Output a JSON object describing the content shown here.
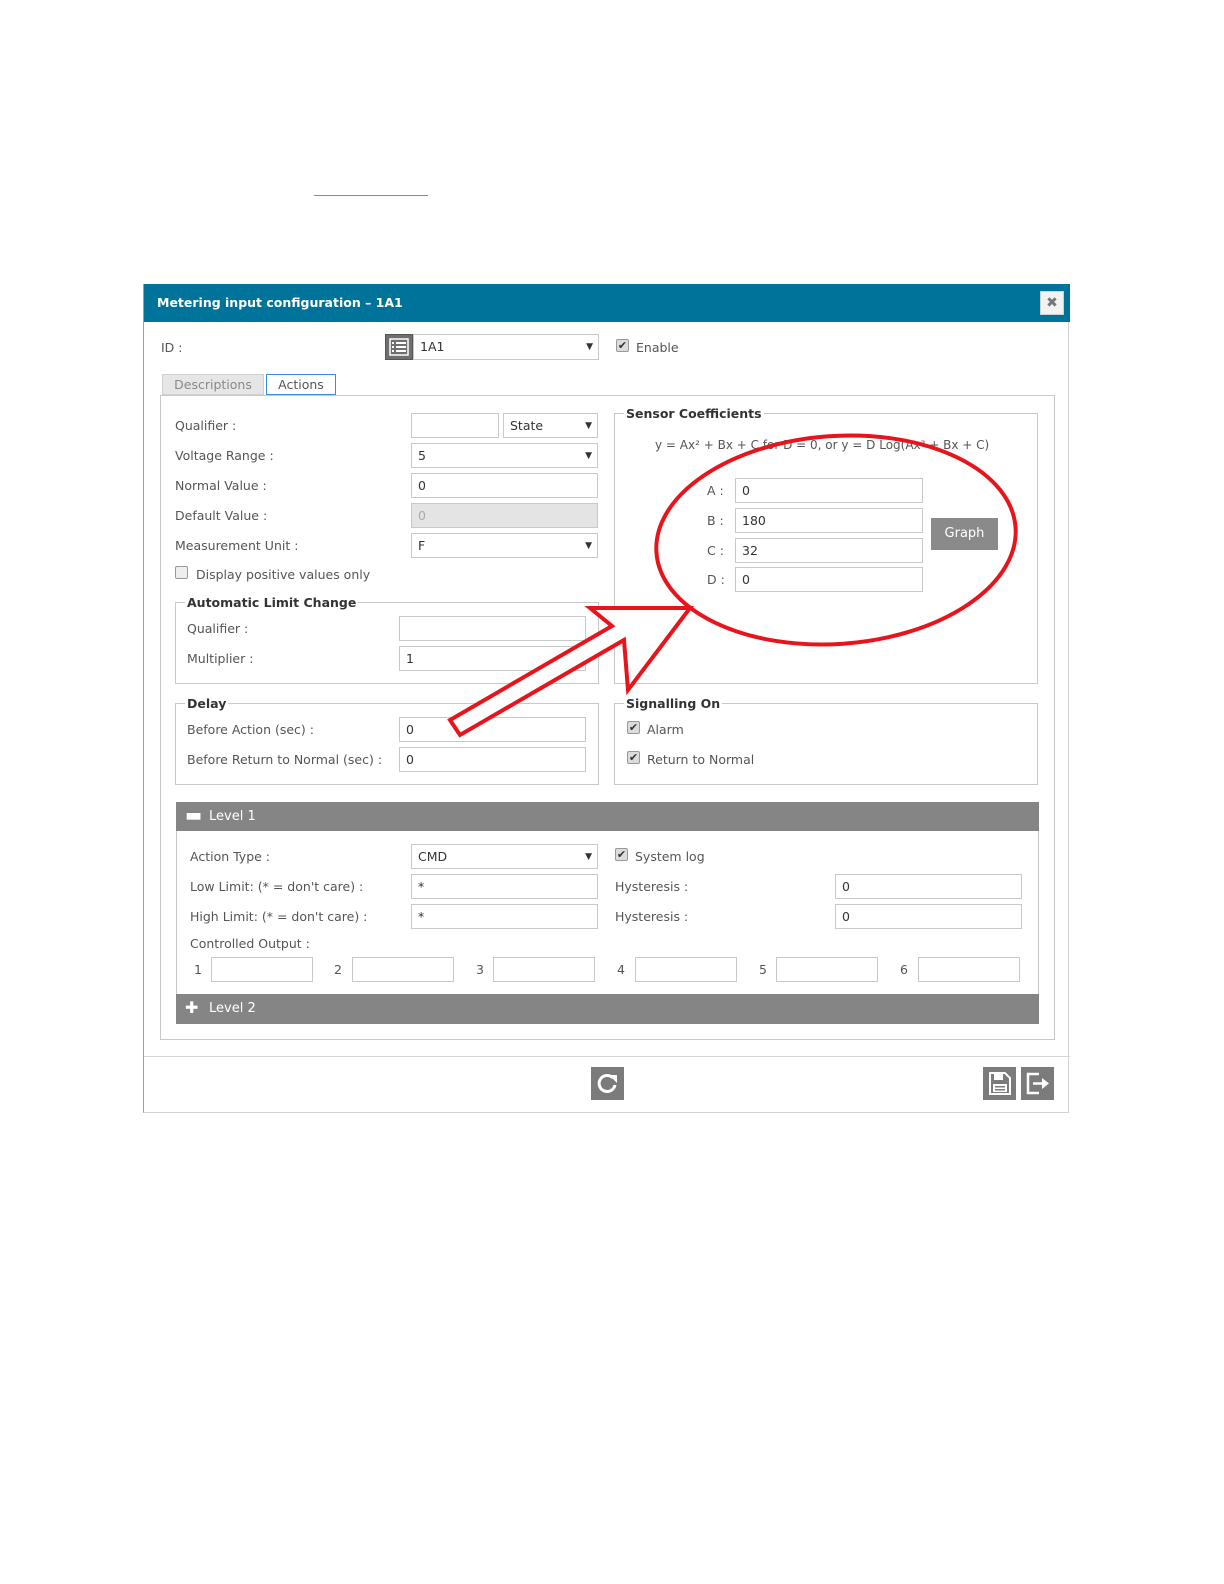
{
  "dialog": {
    "title": "Metering input configuration – 1A1",
    "close_glyph": "✖",
    "id_label": "ID :",
    "id_value": "1A1",
    "enable_label": "Enable",
    "tabs": [
      {
        "label": "Descriptions"
      },
      {
        "label": "Actions"
      }
    ],
    "active_tab": "Actions"
  },
  "left": {
    "qualifier_label": "Qualifier :",
    "qualifier_value": "",
    "qualifier_mode": "State",
    "voltage_label": "Voltage Range :",
    "voltage_value": "5",
    "normal_label": "Normal Value :",
    "normal_value": "0",
    "default_label": "Default Value :",
    "default_value": "0",
    "unit_label": "Measurement Unit :",
    "unit_value": "F",
    "positive_label": "Display positive values only"
  },
  "alc": {
    "legend": "Automatic Limit Change",
    "qualifier_label": "Qualifier :",
    "qualifier_value": "",
    "multiplier_label": "Multiplier :",
    "multiplier_value": "1"
  },
  "delay": {
    "legend": "Delay",
    "before_action_label": "Before Action (sec) :",
    "before_action_value": "0",
    "before_return_label": "Before Return to Normal (sec) :",
    "before_return_value": "0"
  },
  "sensor": {
    "legend": "Sensor Coefficients",
    "formula": "y = Ax² + Bx + C for D = 0, or y = D Log(Ax² + Bx + C)",
    "a_label": "A :",
    "a_value": "0",
    "b_label": "B :",
    "b_value": "180",
    "c_label": "C :",
    "c_value": "32",
    "d_label": "D :",
    "d_value": "0",
    "graph_label": "Graph"
  },
  "signalling": {
    "legend": "Signalling On",
    "alarm_label": "Alarm",
    "return_label": "Return to Normal"
  },
  "level1": {
    "title": "Level 1",
    "toggle_glyph": "▬",
    "action_type_label": "Action Type :",
    "action_type_value": "CMD",
    "syslog_label": "System log",
    "low_label": "Low Limit: (* = don't care) :",
    "low_value": "*",
    "high_label": "High Limit: (* = don't care) :",
    "high_value": "*",
    "hyst1_label": "Hysteresis :",
    "hyst1_value": "0",
    "hyst2_label": "Hysteresis :",
    "hyst2_value": "0",
    "controlled_label": "Controlled Output :",
    "outputs": [
      {
        "num": "1",
        "value": ""
      },
      {
        "num": "2",
        "value": ""
      },
      {
        "num": "3",
        "value": ""
      },
      {
        "num": "4",
        "value": ""
      },
      {
        "num": "5",
        "value": ""
      },
      {
        "num": "6",
        "value": ""
      }
    ]
  },
  "level2": {
    "title": "Level 2",
    "toggle_glyph": "✚"
  },
  "footer": {
    "refresh_icon": "refresh-icon",
    "save_icon": "save-icon",
    "exit_icon": "exit-icon"
  },
  "colors": {
    "titlebar": "#00739a",
    "level_bar": "#858585",
    "annotation": "#e8141c",
    "active_tab_border": "#3b8fd9"
  }
}
